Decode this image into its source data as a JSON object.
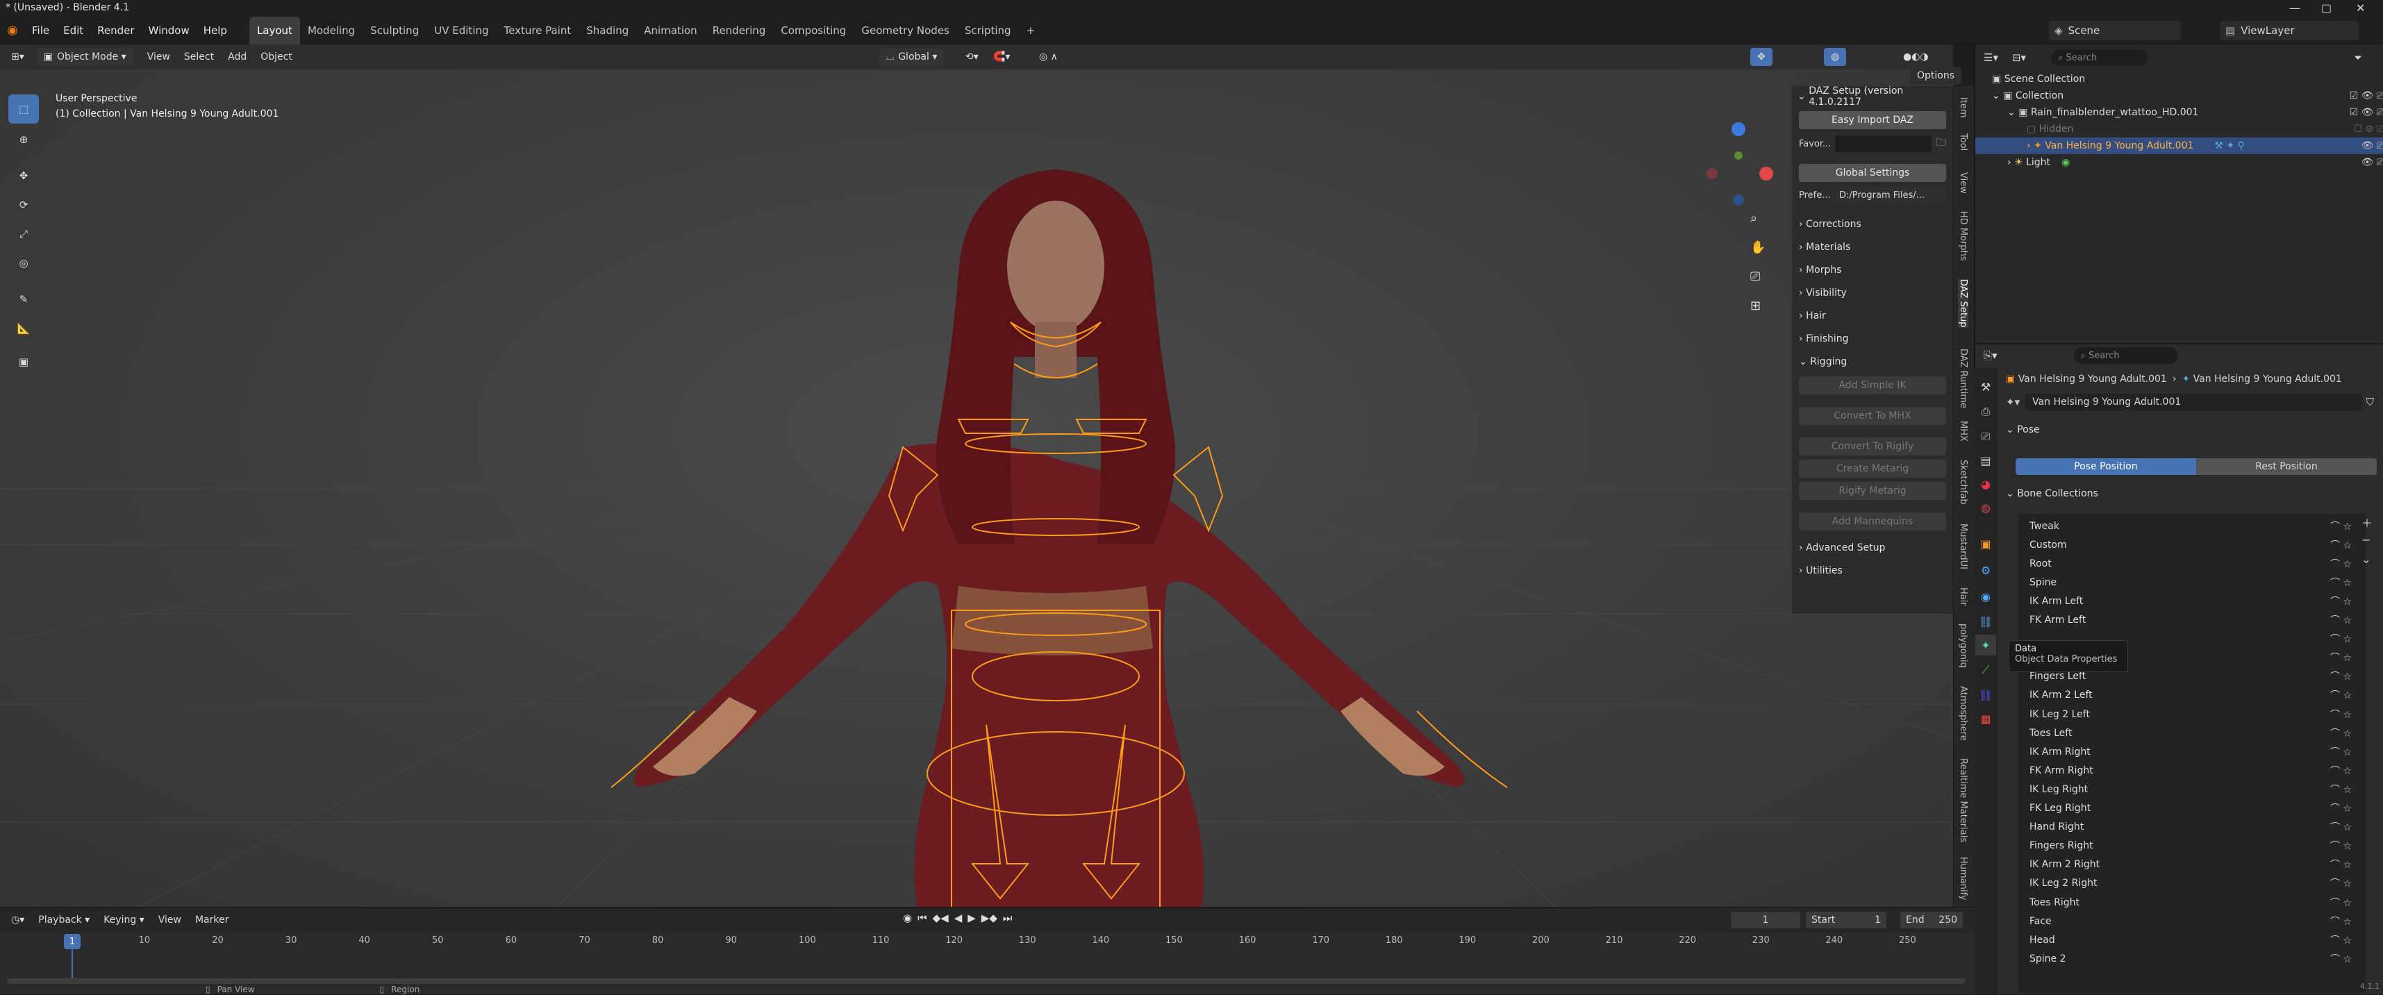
{
  "titlebar": {
    "title": "* (Unsaved) - Blender 4.1"
  },
  "menu": {
    "items": [
      "File",
      "Edit",
      "Render",
      "Window",
      "Help"
    ]
  },
  "workspaces": [
    "Layout",
    "Modeling",
    "Sculpting",
    "UV Editing",
    "Texture Paint",
    "Shading",
    "Animation",
    "Rendering",
    "Compositing",
    "Geometry Nodes",
    "Scripting"
  ],
  "viewport_header": {
    "mode": "Object Mode",
    "menus": [
      "View",
      "Select",
      "Add",
      "Object"
    ],
    "orientation": "Global",
    "options": "Options"
  },
  "viewport": {
    "perspective": "User Perspective",
    "collection": "(1) Collection | Van Helsing 9 Young Adult.001"
  },
  "npanel": {
    "title": "DAZ Setup (version 4.1.0.2117",
    "easy_import": "Easy Import DAZ",
    "favor_label": "Favor...",
    "global_settings": "Global Settings",
    "prefe_label": "Prefe...",
    "prefe_value": "D:/Program Files/...",
    "sections": [
      "Corrections",
      "Materials",
      "Morphs",
      "Visibility",
      "Hair",
      "Finishing"
    ],
    "rigging": "Rigging",
    "rig_buttons": [
      "Add Simple IK",
      "Convert To MHX",
      "Convert To Rigify",
      "Create Metarig",
      "Rigify Metarig",
      "Add Mannequins"
    ],
    "sections2": [
      "Advanced Setup",
      "Utilities"
    ]
  },
  "vtabs": [
    "Item",
    "Tool",
    "View",
    "HD Morphs",
    "DAZ Setup",
    "DAZ Runtime",
    "MHX",
    "Sketchfab",
    "MustardUI",
    "Hair",
    "polygoniq",
    "Atmosphere",
    "Realtime Materials",
    "Humanify"
  ],
  "timeline": {
    "menus": [
      "Playback",
      "Keying",
      "View",
      "Marker"
    ],
    "current_frame": "1",
    "start_label": "Start",
    "start": "1",
    "end_label": "End",
    "end": "250",
    "ticks": [
      "10",
      "20",
      "30",
      "40",
      "50",
      "60",
      "70",
      "80",
      "90",
      "100",
      "110",
      "120",
      "130",
      "140",
      "150",
      "160",
      "170",
      "180",
      "190",
      "200",
      "210",
      "220",
      "230",
      "240",
      "250"
    ],
    "playhead": "1",
    "status_pan": "Pan View",
    "status_region": "Region",
    "version": "4.1.1"
  },
  "topright": {
    "scene": "Scene",
    "viewlayer": "ViewLayer"
  },
  "outliner": {
    "search_placeholder": "Search",
    "rows": [
      "Scene Collection",
      "Collection",
      "Rain_finalblender_wtattoo_HD.001",
      "Hidden",
      "Van Helsing 9 Young Adult.001",
      "Light"
    ]
  },
  "properties": {
    "search_placeholder": "Search",
    "breadcrumb_obj": "Van Helsing 9 Young Adult.001",
    "breadcrumb_data": "Van Helsing 9 Young Adult.001",
    "datablock": "Van Helsing 9 Young Adult.001",
    "pose_section": "Pose",
    "pose_position": "Pose Position",
    "rest_position": "Rest Position",
    "bone_collections": "Bone Collections",
    "tooltip_title": "Data",
    "tooltip_body": "Object Data Properties",
    "collections": [
      "Tweak",
      "Custom",
      "Root",
      "Spine",
      "IK Arm Left",
      "FK Arm Left",
      "",
      "Hand Left",
      "Fingers Left",
      "IK Arm 2 Left",
      "IK Leg 2 Left",
      "Toes Left",
      "IK Arm Right",
      "FK Arm Right",
      "IK Leg Right",
      "FK Leg Right",
      "Hand Right",
      "Fingers Right",
      "IK Arm 2 Right",
      "IK Leg 2 Right",
      "Toes Right",
      "Face",
      "Head",
      "Spine 2"
    ]
  },
  "colors": {
    "accent": "#4772b3",
    "orange": "#ff9a1a",
    "selected": "#334d80"
  }
}
